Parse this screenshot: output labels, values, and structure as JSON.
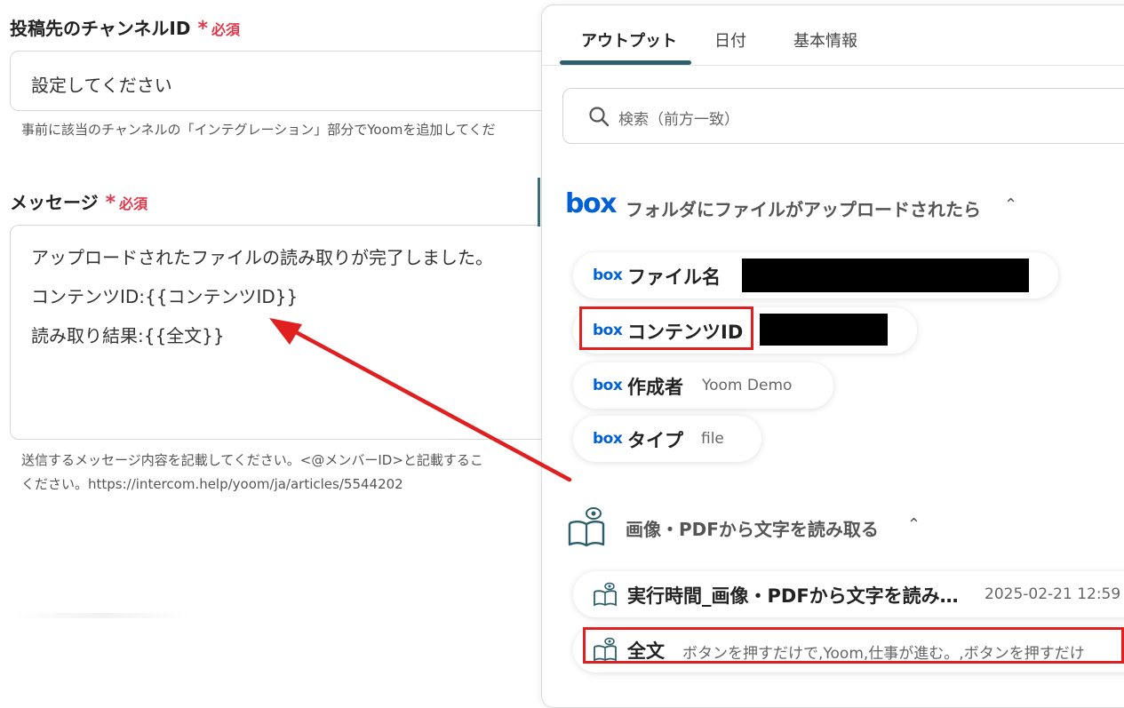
{
  "form": {
    "channel_label": "投稿先のチャンネルID",
    "required_mark": "*",
    "required_text": "必須",
    "channel_value": "設定してください",
    "channel_help": "事前に該当のチャンネルの「インテグレーション」部分でYoomを追加してくだ",
    "message_label": "メッセージ",
    "message_lines": [
      "アップロードされたファイルの読み取りが完了しました。",
      "コンテンツID:{{コンテンツID}}",
      "読み取り結果:{{全文}}"
    ],
    "message_help_1": "送信するメッセージ内容を記載してください。<@メンバーID>と記載するこ",
    "message_help_2": "ください。https://intercom.help/yoom/ja/articles/5544202"
  },
  "panel": {
    "tabs": [
      "アウトプット",
      "日付",
      "基本情報"
    ],
    "active_tab": "アウトプット",
    "search_placeholder": "検索（前方一致）",
    "box_logo": "box",
    "sections": [
      {
        "title": "フォルダにファイルがアップロードされたら",
        "icon": "box-logo",
        "items": [
          {
            "name": "ファイル名",
            "value": ""
          },
          {
            "name": "コンテンツID",
            "value": ""
          },
          {
            "name": "作成者",
            "value": "Yoom Demo"
          },
          {
            "name": "タイプ",
            "value": "file"
          }
        ]
      },
      {
        "title": "画像・PDFから文字を読み取る",
        "icon": "book-eye-icon",
        "items": [
          {
            "name": "実行時間_画像・PDFから文字を読み…",
            "value": "2025-02-21 12:59"
          },
          {
            "name": "全文",
            "value": "ボタンを押すだけで,Yoom,仕事が進む。,ボタンを押すだけ"
          }
        ]
      }
    ]
  },
  "colors": {
    "required": "#e2394a",
    "accent": "#2c5f6b",
    "box_blue": "#0061d5",
    "highlight": "#e02020"
  }
}
